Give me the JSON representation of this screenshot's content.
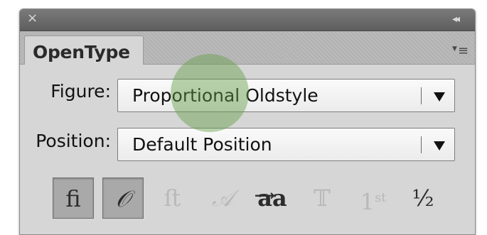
{
  "titlebar": {
    "close_icon": "close-icon",
    "close_glyph": "×",
    "collapse_icon": "double-chevron-left-icon",
    "collapse_glyph": "◂◂"
  },
  "tabs": [
    {
      "label": "OpenType",
      "active": true
    }
  ],
  "panel_menu_icon": "panel-menu-icon",
  "figure": {
    "label": "Figure:",
    "value": "Proportional Oldstyle"
  },
  "position": {
    "label": "Position:",
    "value": "Default Position"
  },
  "glyph_buttons": [
    {
      "name": "standard-ligatures-button",
      "glyph": "ﬁ",
      "state": "on"
    },
    {
      "name": "contextual-alternates-button",
      "glyph": "𝒪",
      "state": "on"
    },
    {
      "name": "discretionary-ligatures-button",
      "glyph": "ﬅ",
      "state": "disabled"
    },
    {
      "name": "swash-button",
      "glyph": "𝒜",
      "state": "disabled"
    },
    {
      "name": "stylistic-alternates-button",
      "glyph": "aa",
      "state": "enabled"
    },
    {
      "name": "titling-alternates-button",
      "glyph": "𝕋",
      "state": "disabled"
    },
    {
      "name": "ordinals-button",
      "glyph": "1st",
      "state": "disabled"
    },
    {
      "name": "fractions-button",
      "glyph": "½",
      "state": "enabled"
    }
  ],
  "colors": {
    "panel_bg": "#d6d6d6",
    "titlebar_bg": "#6b6b6b",
    "active_button_bg": "#a9a9a9",
    "disabled_glyph": "#b9b9b9",
    "touch_indicator": "#64a046"
  }
}
